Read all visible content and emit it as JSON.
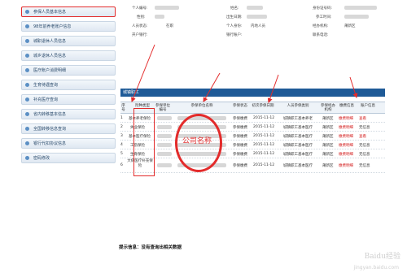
{
  "sidebar": {
    "items": [
      {
        "label": "参保人员基本信息",
        "active": true
      },
      {
        "label": "98年前养老账户信息"
      },
      {
        "label": "城职退休人员信息"
      },
      {
        "label": "城乡退休人员信息"
      },
      {
        "label": "医疗账户消费明细"
      },
      {
        "label": "生育待遇查询"
      },
      {
        "label": "补充医疗查询"
      },
      {
        "label": "省内转移基本信息"
      },
      {
        "label": "全国转移信息查询"
      },
      {
        "label": "银行代扣协议信息"
      },
      {
        "label": "密码修改"
      }
    ]
  },
  "info": {
    "labels": {
      "personal_no": "个人编号:",
      "name": "姓名:",
      "id_no": "身份证号码:",
      "gender": "性别:",
      "birth_date": "出生日期:",
      "work_date": "参工时间:",
      "status": "人员状态:",
      "identity": "个人身份:",
      "agency": "经办机构:",
      "bank": "开户银行:",
      "account": "银行账户:",
      "contact": "联系电话:"
    },
    "values": {
      "status": "在职",
      "identity": "内地人员",
      "agency": "莆新区"
    }
  },
  "section_title": "城镇职工",
  "table": {
    "headers": [
      "序号",
      "险种类型",
      "参保单位编号",
      "参保单位名称",
      "参保状态",
      "初次参保日期",
      "人员参保类别",
      "参保经办机构",
      "缴费信息",
      "账户信息"
    ],
    "rows": [
      {
        "no": "1",
        "type": "基本养老保险",
        "state": "参保缴费",
        "date": "2015-11-12",
        "category": "城镇职工基本养老",
        "agency": "莆新区",
        "pay": "缴费明细",
        "acct": "查看"
      },
      {
        "no": "2",
        "type": "失业保险",
        "state": "参保缴费",
        "date": "2015-11-12",
        "category": "城镇职工基本医疗",
        "agency": "莆新区",
        "pay": "缴费明细",
        "acct": "无信息"
      },
      {
        "no": "3",
        "type": "基本医疗保险",
        "state": "参保缴费",
        "date": "2015-11-12",
        "category": "城镇职工基本医疗",
        "agency": "莆新区",
        "pay": "缴费明细",
        "acct": "查看"
      },
      {
        "no": "4",
        "type": "工伤保险",
        "state": "参保缴费",
        "date": "2015-11-12",
        "category": "城镇职工基本医疗",
        "agency": "莆新区",
        "pay": "缴费明细",
        "acct": "无信息"
      },
      {
        "no": "5",
        "type": "生育保险",
        "state": "参保缴费",
        "date": "2015-11-12",
        "category": "城镇职工基本医疗",
        "agency": "莆新区",
        "pay": "缴费明细",
        "acct": "无信息"
      },
      {
        "no": "6",
        "type": "大病医疗补充保险",
        "state": "参保缴费",
        "date": "2015-11-12",
        "category": "城镇职工基本医疗",
        "agency": "莆新区",
        "pay": "缴费明细",
        "acct": "无信息"
      }
    ]
  },
  "annotation": {
    "company": "公司名称"
  },
  "message": "提示信息：没有查询出相关数据",
  "watermark": {
    "brand": "Baidu经验",
    "url": "jingyan.baidu.com"
  },
  "colors": {
    "accent": "#e32b2b",
    "header": "#1e5a97",
    "link": "#1a56b0"
  }
}
